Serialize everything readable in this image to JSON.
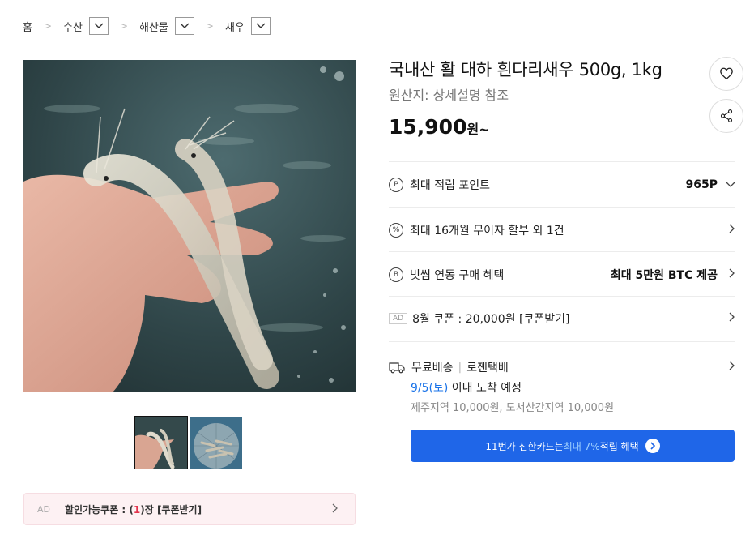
{
  "breadcrumb": {
    "home": "홈",
    "level1": "수산",
    "level2": "해산물",
    "level3": "새우"
  },
  "product": {
    "title": "국내산 활 대하 흰다리새우 500g, 1kg",
    "origin": "원산지:  상세설명 참조",
    "price": "15,900",
    "price_unit": "원~"
  },
  "benefits": {
    "points_label": "최대 적립 포인트",
    "points_value": "965P",
    "installment_label": "최대 16개월 무이자 할부 외 1건",
    "bithumb_label": "빗썸 연동 구매 혜택",
    "bithumb_value": "최대 5만원 BTC 제공",
    "coupon_label": "8월 쿠폰 : 20,000원 [쿠폰받기]",
    "ad_tag": "AD"
  },
  "delivery": {
    "label": "무료배송",
    "divider": "|",
    "carrier": "로젠택배",
    "eta_date": "9/5(토)",
    "eta_text": " 이내 도착 예정",
    "extra": "제주지역 10,000원, 도서산간지역 10,000원"
  },
  "card_banner": {
    "prefix": "11번가 신한카드는 ",
    "highlight": "최대 7%",
    "suffix": " 적립 혜택"
  },
  "ad_coupon": {
    "tag": "AD",
    "prefix": "할인가능쿠폰 : (",
    "count": "1",
    "suffix": ")장 [쿠폰받기]"
  },
  "icons": {
    "point": "P",
    "installment": "%",
    "bithumb": "B"
  },
  "colors": {
    "accent_blue": "#1f66e8",
    "coupon_red": "#e3324b",
    "coupon_bg": "#fdf1f3"
  }
}
